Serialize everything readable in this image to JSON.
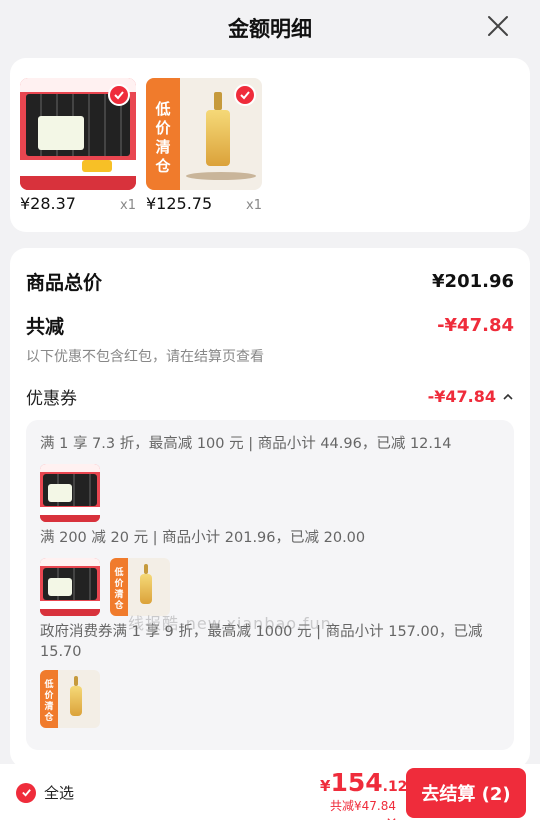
{
  "header": {
    "title": "金额明细"
  },
  "products": [
    {
      "price": "¥28.37",
      "qty": "x1"
    },
    {
      "price": "¥125.75",
      "qty": "x1"
    }
  ],
  "summary": {
    "goods_total_label": "商品总价",
    "goods_total_value": "¥201.96",
    "discount_label": "共减",
    "discount_value": "-¥47.84",
    "note": "以下优惠不包含红包，请在结算页查看",
    "coupon_label": "优惠券",
    "coupon_value": "-¥47.84"
  },
  "coupon_rules": [
    {
      "text": "满 1 享 7.3 折，最高减 100 元 | 商品小计 44.96，已减 12.14"
    },
    {
      "text": "满 200 减 20 元 | 商品小计 201.96，已减 20.00"
    },
    {
      "text": "政府消费券满 1 享 9 折，最高减 1000 元 | 商品小计 157.00，已减 15.70"
    }
  ],
  "watermark": "线报酷-new.xianbao.fun",
  "bottom": {
    "select_all": "全选",
    "currency": "¥",
    "total_int": "154",
    "total_dec": ".12",
    "total_discount": "共减¥47.84",
    "checkout": "去结算 (2)"
  },
  "colors": {
    "accent": "#ef2c3b",
    "background": "#f2f2f4"
  }
}
